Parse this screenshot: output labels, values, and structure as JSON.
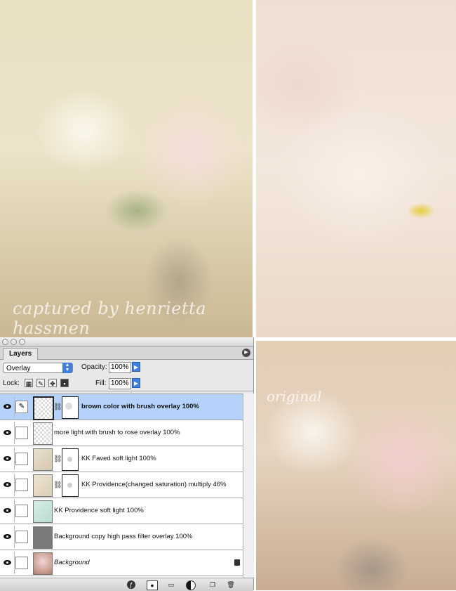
{
  "watermarks": {
    "captured": "captured by henrietta hassmen",
    "original": "original"
  },
  "panel": {
    "tab_label": "Layers",
    "blend_mode": "Overlay",
    "opacity_label": "Opacity:",
    "opacity_value": "100%",
    "lock_label": "Lock:",
    "fill_label": "Fill:",
    "fill_value": "100%",
    "icons": [
      "panel-menu-icon",
      "lock-transparent-icon",
      "lock-paint-icon",
      "lock-move-icon",
      "lock-all-icon",
      "link-layers-icon",
      "layer-style-icon",
      "layer-mask-icon",
      "new-group-icon",
      "adjustment-layer-icon",
      "new-layer-icon",
      "trash-icon"
    ]
  },
  "layers": [
    {
      "name": "brown color with brush overlay 100%",
      "selected": true
    },
    {
      "name": "more light with brush to rose overlay 100%"
    },
    {
      "name": "KK Faved soft light 100%"
    },
    {
      "name": "KK Providence(changed saturation) multiply 46%"
    },
    {
      "name": "KK Providence soft light 100%"
    },
    {
      "name": "Background copy high pass filter overlay 100%"
    },
    {
      "name": "Background",
      "locked": true
    }
  ]
}
